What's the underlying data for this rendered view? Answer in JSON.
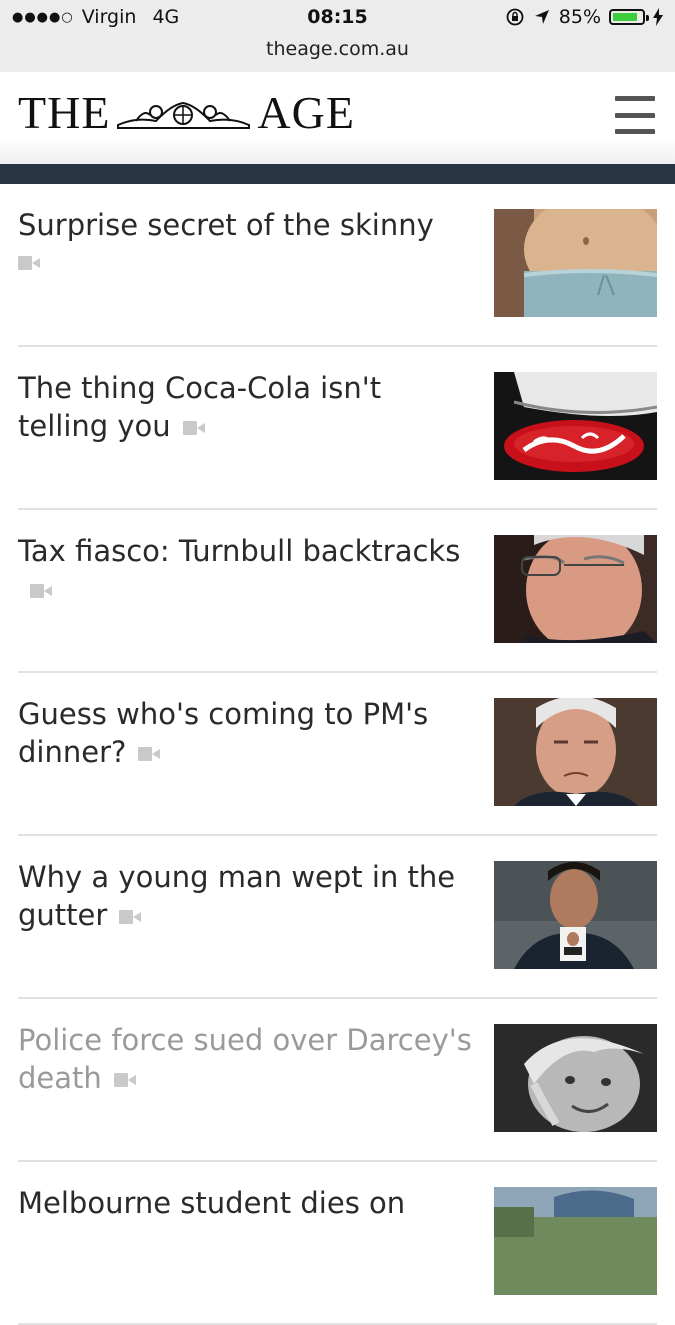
{
  "status_bar": {
    "carrier": "Virgin",
    "network": "4G",
    "time": "08:15",
    "battery": "85%",
    "battery_level": 0.85,
    "signal_icon": "signal-dots-icon",
    "lock_icon": "rotation-lock-icon",
    "location_icon": "location-arrow-icon",
    "charging_icon": "charging-bolt-icon"
  },
  "browser": {
    "url": "theage.com.au"
  },
  "masthead": {
    "logo_left": "THE",
    "logo_right": "AGE",
    "menu_icon": "hamburger-menu-icon",
    "band_color": "#273545"
  },
  "articles": [
    {
      "title": "Surprise secret of the skinny",
      "video_icon": "video-camera-icon",
      "thumb": "midriff-photo"
    },
    {
      "title": "The thing Coca-Cola isn't telling you",
      "video_icon": "video-camera-icon",
      "thumb": "coca-cola-can-photo"
    },
    {
      "title": "Tax fiasco: Turnbull backtracks",
      "video_icon": "video-camera-icon",
      "thumb": "turnbull-profile-photo"
    },
    {
      "title": "Guess who's coming to PM's dinner?",
      "video_icon": "video-camera-icon",
      "thumb": "turnbull-portrait-photo"
    },
    {
      "title": "Why a young man wept in the gutter",
      "video_icon": "video-camera-icon",
      "thumb": "young-man-id-photo"
    },
    {
      "title": "Police force sued over Darcey's death",
      "video_icon": "video-camera-icon",
      "thumb": "child-bw-photo",
      "visited": true
    },
    {
      "title": "Melbourne student dies on",
      "thumb": "street-photo"
    }
  ]
}
